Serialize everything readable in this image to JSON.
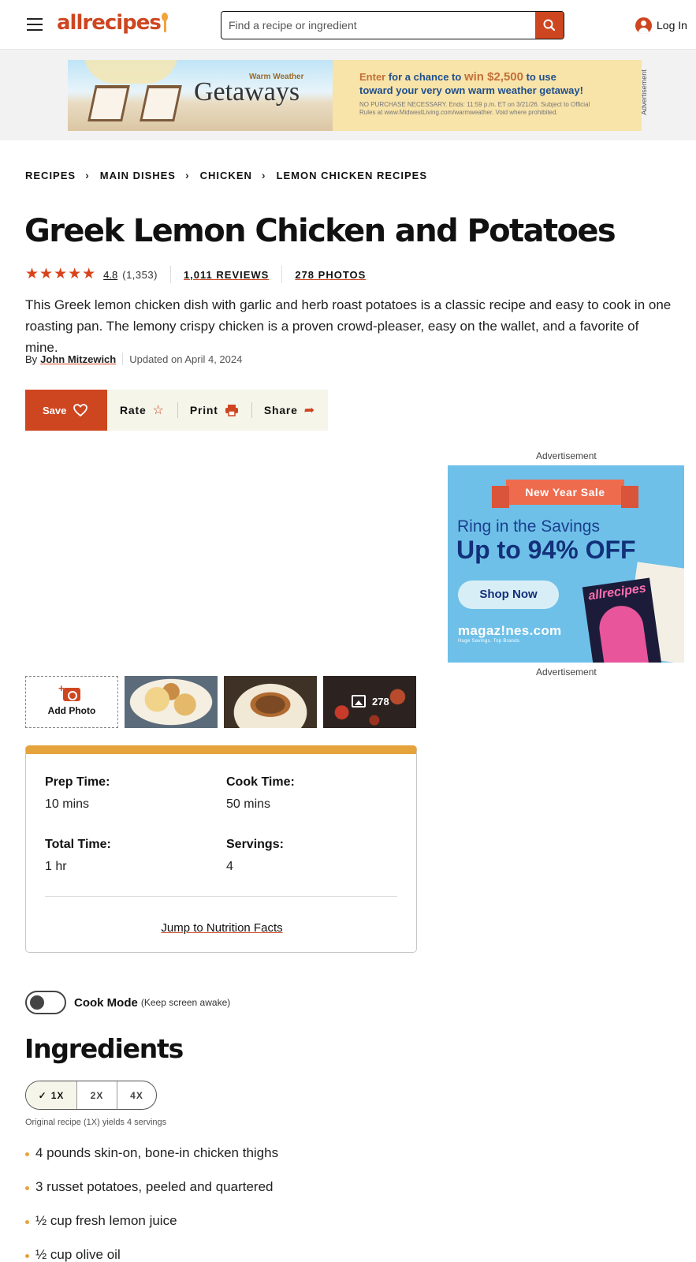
{
  "header": {
    "logo_text": "allrecipes",
    "search_placeholder": "Find a recipe or ingredient",
    "login_label": "Log In"
  },
  "top_ad": {
    "side_label": "Advertisement",
    "kicker": "Warm Weather",
    "headline": "Getaways",
    "line1_enter": "Enter",
    "line1_mid": " for a chance to ",
    "line1_amount": "win $2,500",
    "line1_end": " to use",
    "line2": "toward your very own warm weather getaway!",
    "fine_print": "NO PURCHASE NECESSARY. Ends: 11:59 p.m. ET on 3/21/26. Subject to Official Rules at www.MidwestLiving.com/warmweather. Void where prohibited."
  },
  "breadcrumb": [
    "RECIPES",
    "MAIN DISHES",
    "CHICKEN",
    "LEMON CHICKEN RECIPES"
  ],
  "recipe": {
    "title": "Greek Lemon Chicken and Potatoes",
    "stars": "★★★★★",
    "rating": "4.8",
    "rating_count": "(1,353)",
    "reviews_link": "1,011 REVIEWS",
    "photos_link": "278 PHOTOS",
    "description": "This Greek lemon chicken dish with garlic and herb roast potatoes is a classic recipe and easy to cook in one roasting pan. The lemony crispy chicken is a proven crowd-pleaser, easy on the wallet, and a favorite of mine.",
    "by_prefix": "By",
    "author": "John Mitzewich",
    "updated": "Updated on April 4, 2024"
  },
  "actions": {
    "save": "Save",
    "rate": "Rate",
    "print": "Print",
    "share": "Share"
  },
  "side_ad": {
    "caption": "Advertisement",
    "ribbon": "New Year Sale",
    "line1": "Ring in the Savings",
    "line2": "Up to 94% OFF",
    "cta": "Shop Now",
    "brand": "magaz!nes.com",
    "brand_tag": "Huge Savings. Top Brands",
    "cover_title": "allrecipes"
  },
  "thumbnails": {
    "add_photo": "Add Photo",
    "photo_count": "278"
  },
  "details": {
    "prep_label": "Prep Time:",
    "prep_value": "10 mins",
    "cook_label": "Cook Time:",
    "cook_value": "50 mins",
    "total_label": "Total Time:",
    "total_value": "1 hr",
    "servings_label": "Servings:",
    "servings_value": "4",
    "jump_link": "Jump to Nutrition Facts",
    "accent_color": "#e5a33c"
  },
  "cook_mode": {
    "label": "Cook Mode",
    "sub": "(Keep screen awake)",
    "enabled": false
  },
  "ingredients": {
    "heading": "Ingredients",
    "scales": [
      "1X",
      "2X",
      "4X"
    ],
    "selected_scale": "1X",
    "yields_note": "Original recipe (1X) yields 4 servings",
    "items": [
      "4 pounds skin-on, bone-in chicken thighs",
      "3 russet potatoes, peeled and quartered",
      "½ cup fresh lemon juice",
      "½ cup olive oil"
    ]
  },
  "colors": {
    "brand": "#ce4620",
    "accent": "#e5a33c",
    "action_bg": "#f5f5ea"
  }
}
